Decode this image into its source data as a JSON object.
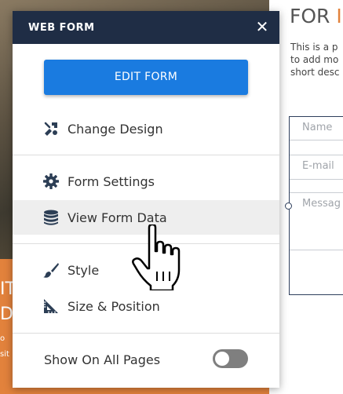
{
  "background": {
    "heading_visible": "FOR",
    "heading_accent": "I",
    "description_lines": [
      "This is a p",
      "to add mo",
      "short desc"
    ],
    "form_fields": {
      "name_placeholder": "Name",
      "email_placeholder": "E-mail",
      "message_placeholder": "Messag"
    },
    "left_lines": [
      "IT",
      "D",
      "o",
      "sit"
    ]
  },
  "panel": {
    "title": "WEB FORM",
    "close_symbol": "✕",
    "primary_button": "EDIT FORM",
    "items": [
      {
        "label": "Change Design",
        "icon": "brush-palette-icon"
      },
      {
        "label": "Form Settings",
        "icon": "gear-icon"
      },
      {
        "label": "View Form Data",
        "icon": "database-icon",
        "hovered": true
      },
      {
        "label": "Style",
        "icon": "paint-brush-icon"
      },
      {
        "label": "Size & Position",
        "icon": "ruler-triangle-icon"
      }
    ],
    "toggle": {
      "label": "Show On All Pages",
      "on": false
    }
  },
  "colors": {
    "header_bg": "#1f2d45",
    "primary_button": "#1a7be0",
    "accent_orange": "#e2823c",
    "hover_row": "#eeeeee"
  }
}
